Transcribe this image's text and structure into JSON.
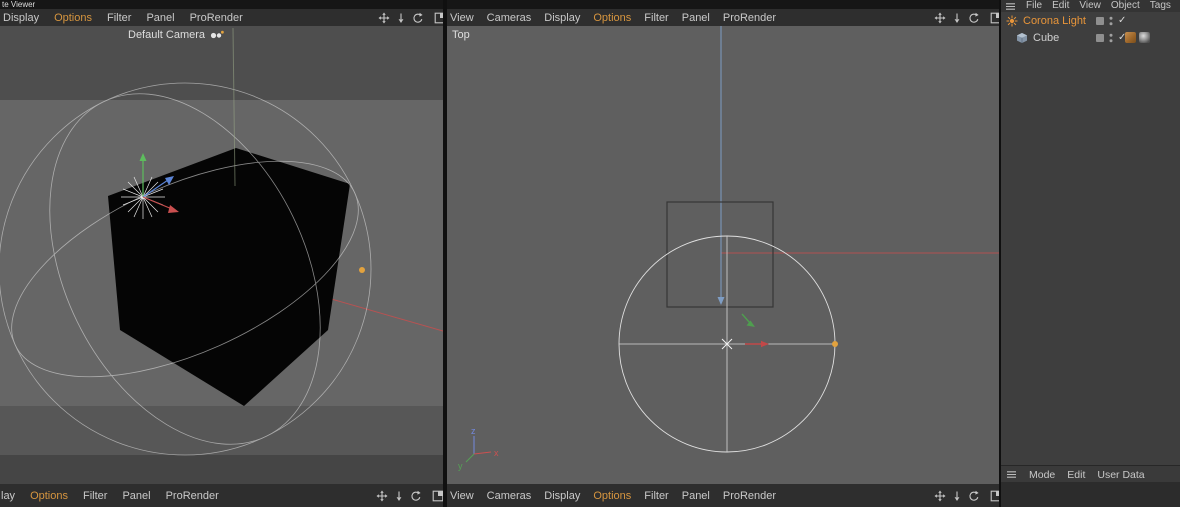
{
  "window": {
    "title_fragment": "te Viewer"
  },
  "colors": {
    "menu_active_orange": "#d6953f",
    "selected_object_orange": "#e8953a",
    "menubar_bg": "#2e2e2e",
    "left_viewport_bg": "#656565",
    "top_viewport_bg": "#5f5f5f",
    "panel_bg": "#3e3e3e"
  },
  "left_viewport": {
    "top_menu": {
      "items": [
        "Display",
        "Options",
        "Filter",
        "Panel",
        "ProRender"
      ],
      "active": "Options"
    },
    "camera_label": "Default Camera",
    "bottom_menu": {
      "items": [
        "lay",
        "Options",
        "Filter",
        "Panel",
        "ProRender"
      ],
      "active": "Options"
    }
  },
  "top_viewport": {
    "view_label": "Top",
    "top_menu": {
      "items": [
        "View",
        "Cameras",
        "Display",
        "Options",
        "Filter",
        "Panel",
        "ProRender"
      ],
      "active": "Options"
    },
    "bottom_menu": {
      "items": [
        "View",
        "Cameras",
        "Display",
        "Options",
        "Filter",
        "Panel",
        "ProRender"
      ],
      "active": "Options"
    },
    "axis_gizmo": {
      "z": "z",
      "x": "x",
      "y": "y"
    }
  },
  "object_manager": {
    "top_menu": {
      "items": [
        "File",
        "Edit",
        "View",
        "Object",
        "Tags"
      ]
    },
    "objects": [
      {
        "name": "Corona Light"
      },
      {
        "name": "Cube"
      }
    ],
    "check_glyph": "✓",
    "bottom_menu": {
      "items": [
        "Mode",
        "Edit",
        "User Data"
      ]
    }
  }
}
